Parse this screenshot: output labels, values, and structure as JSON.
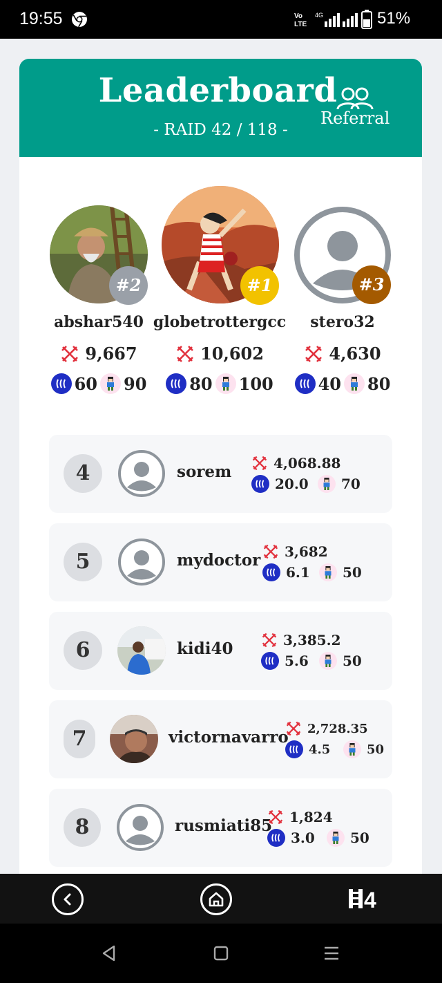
{
  "status_bar": {
    "time": "19:55",
    "battery": "51%",
    "network": "4G"
  },
  "header": {
    "title": "Leaderboard",
    "subtitle": "- RAID 42 / 118 -",
    "referral_label": "Referral",
    "referral_icon": "people-icon",
    "color": "#009c8a"
  },
  "podium": [
    {
      "rank_label": "#2",
      "username": "abshar540",
      "power": "9,667",
      "coins": "60",
      "sprites": "90",
      "badge_color": "#9aa0a8"
    },
    {
      "rank_label": "#1",
      "username": "globetrottergcc",
      "power": "10,602",
      "coins": "80",
      "sprites": "100",
      "badge_color": "#f2c200"
    },
    {
      "rank_label": "#3",
      "username": "stero32",
      "power": "4,630",
      "coins": "40",
      "sprites": "80",
      "badge_color": "#a45a00"
    }
  ],
  "rows": [
    {
      "rank": "4",
      "username": "sorem",
      "power": "4,068.88",
      "coins": "20.0",
      "sprites": "70"
    },
    {
      "rank": "5",
      "username": "mydoctor",
      "power": "3,682",
      "coins": "6.1",
      "sprites": "50"
    },
    {
      "rank": "6",
      "username": "kidi40",
      "power": "3,385.2",
      "coins": "5.6",
      "sprites": "50"
    },
    {
      "rank": "7",
      "username": "victornavarro",
      "power": "2,728.35",
      "coins": "4.5",
      "sprites": "50"
    },
    {
      "rank": "8",
      "username": "rusmiati85",
      "power": "1,824",
      "coins": "3.0",
      "sprites": "50"
    }
  ],
  "bottom_nav": {
    "back_icon": "chevron-left-icon",
    "home_icon": "home-icon",
    "logo_text": "H4"
  }
}
